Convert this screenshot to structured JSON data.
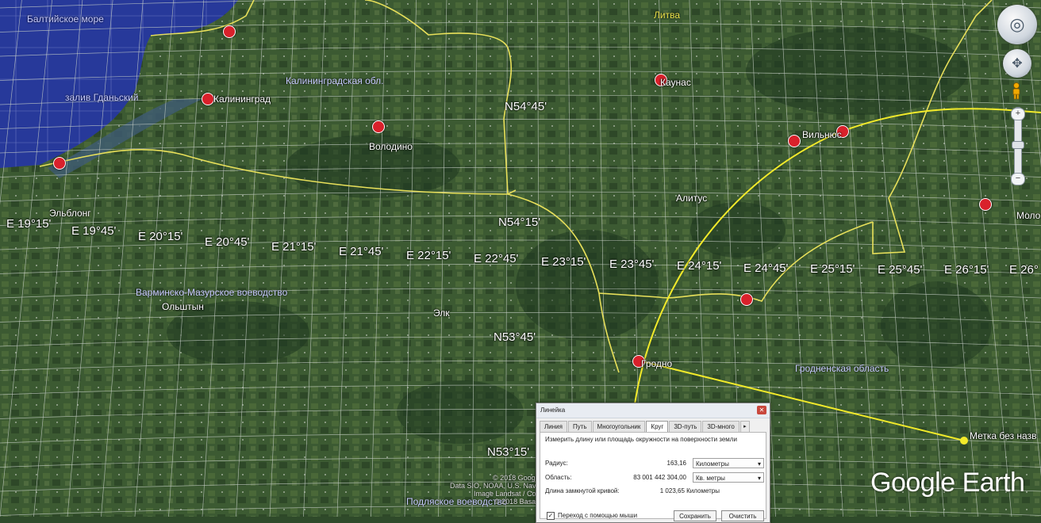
{
  "map": {
    "sea_color": "#2a3e9a",
    "land_color": "#3c5a32",
    "grid_color": "#c8d0c8",
    "border_color": "#e8e05a",
    "measure_color": "#f2ea2a",
    "grid_labels": [
      {
        "text": "N54°45'"
      },
      {
        "text": "N54°15'"
      },
      {
        "text": "N53°45'"
      },
      {
        "text": "N53°15'"
      },
      {
        "text": "E 19°15'"
      },
      {
        "text": "E 19°45'"
      },
      {
        "text": "E 20°15'"
      },
      {
        "text": "E 20°45'"
      },
      {
        "text": "E 21°15'"
      },
      {
        "text": "E 21°45'"
      },
      {
        "text": "E 22°15'"
      },
      {
        "text": "E 22°45'"
      },
      {
        "text": "E 23°15'"
      },
      {
        "text": "E 23°45'"
      },
      {
        "text": "E 24°15'"
      },
      {
        "text": "E 24°45'"
      },
      {
        "text": "E 25°15'"
      },
      {
        "text": "E 25°45'"
      },
      {
        "text": "E 26°15'"
      },
      {
        "text": "E 26°"
      }
    ],
    "places": {
      "country": "Литва",
      "region_kaliningrad": "Калининградская обл.",
      "region_warmia": "Варминско-Мазурское воеводство",
      "region_podlaskie": "Подляское воеводство",
      "region_grodno": "Гродненская область",
      "gulf": "залив Гданьский",
      "sea": "Балтийское море",
      "kaliningrad": "Калининград",
      "volodino": "Володино",
      "kaunas": "Каунас",
      "vilnius": "Вильнюс",
      "alytus": "Алитус",
      "elblong": "Эльблонг",
      "olsztyn": "Ольштын",
      "elk": "Элк",
      "grodno": "Гродно",
      "molodechno": "Моло",
      "placemark": "Метка без назв"
    },
    "attribution": {
      "line1": "© 2018 Google",
      "line2": "Data SIO, NOAA, U.S. Navy, NGA, GEBCO",
      "line3": "Image Landsat / Copernicus",
      "line4": "© 2018 Basarsoft"
    },
    "logo": "Google Earth"
  },
  "nav": {
    "look_icon": "look-joystick-icon",
    "move_icon": "move-joystick-icon",
    "pegman_icon": "street-view-pegman-icon",
    "zoom_in": "+",
    "zoom_out": "−"
  },
  "ruler": {
    "title": "Линейка",
    "close": "✕",
    "tabs": [
      "Линия",
      "Путь",
      "Многоугольник",
      "Круг",
      "3D-путь",
      "3D-много"
    ],
    "active_tab": "Круг",
    "tabs_arrow": "▸",
    "description": "Измерить длину или площадь окружности на поверхности земли",
    "radius_label": "Радиус:",
    "radius_value": "163,16",
    "radius_unit": "Километры",
    "area_label": "Область:",
    "area_value": "83 001 442 304,00",
    "area_unit": "Кв. метры",
    "perimeter_label": "Длина замкнутой кривой:",
    "perimeter_value": "1 023,65 Километры",
    "mouse_nav_label": "Переход с помощью мыши",
    "mouse_nav_checked": "✓",
    "save_button": "Сохранить",
    "clear_button": "Очистить"
  }
}
